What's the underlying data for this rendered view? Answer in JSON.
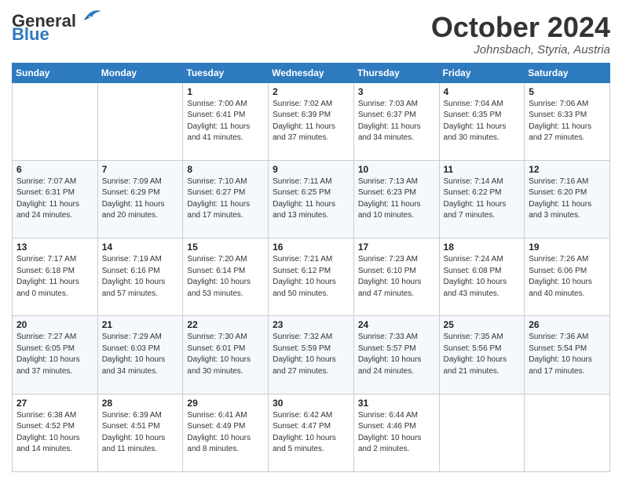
{
  "header": {
    "logo_line1": "General",
    "logo_line2": "Blue",
    "title": "October 2024",
    "location": "Johnsbach, Styria, Austria"
  },
  "weekdays": [
    "Sunday",
    "Monday",
    "Tuesday",
    "Wednesday",
    "Thursday",
    "Friday",
    "Saturday"
  ],
  "weeks": [
    [
      null,
      null,
      {
        "day": 1,
        "sunrise": "Sunrise: 7:00 AM",
        "sunset": "Sunset: 6:41 PM",
        "daylight": "Daylight: 11 hours and 41 minutes."
      },
      {
        "day": 2,
        "sunrise": "Sunrise: 7:02 AM",
        "sunset": "Sunset: 6:39 PM",
        "daylight": "Daylight: 11 hours and 37 minutes."
      },
      {
        "day": 3,
        "sunrise": "Sunrise: 7:03 AM",
        "sunset": "Sunset: 6:37 PM",
        "daylight": "Daylight: 11 hours and 34 minutes."
      },
      {
        "day": 4,
        "sunrise": "Sunrise: 7:04 AM",
        "sunset": "Sunset: 6:35 PM",
        "daylight": "Daylight: 11 hours and 30 minutes."
      },
      {
        "day": 5,
        "sunrise": "Sunrise: 7:06 AM",
        "sunset": "Sunset: 6:33 PM",
        "daylight": "Daylight: 11 hours and 27 minutes."
      }
    ],
    [
      {
        "day": 6,
        "sunrise": "Sunrise: 7:07 AM",
        "sunset": "Sunset: 6:31 PM",
        "daylight": "Daylight: 11 hours and 24 minutes."
      },
      {
        "day": 7,
        "sunrise": "Sunrise: 7:09 AM",
        "sunset": "Sunset: 6:29 PM",
        "daylight": "Daylight: 11 hours and 20 minutes."
      },
      {
        "day": 8,
        "sunrise": "Sunrise: 7:10 AM",
        "sunset": "Sunset: 6:27 PM",
        "daylight": "Daylight: 11 hours and 17 minutes."
      },
      {
        "day": 9,
        "sunrise": "Sunrise: 7:11 AM",
        "sunset": "Sunset: 6:25 PM",
        "daylight": "Daylight: 11 hours and 13 minutes."
      },
      {
        "day": 10,
        "sunrise": "Sunrise: 7:13 AM",
        "sunset": "Sunset: 6:23 PM",
        "daylight": "Daylight: 11 hours and 10 minutes."
      },
      {
        "day": 11,
        "sunrise": "Sunrise: 7:14 AM",
        "sunset": "Sunset: 6:22 PM",
        "daylight": "Daylight: 11 hours and 7 minutes."
      },
      {
        "day": 12,
        "sunrise": "Sunrise: 7:16 AM",
        "sunset": "Sunset: 6:20 PM",
        "daylight": "Daylight: 11 hours and 3 minutes."
      }
    ],
    [
      {
        "day": 13,
        "sunrise": "Sunrise: 7:17 AM",
        "sunset": "Sunset: 6:18 PM",
        "daylight": "Daylight: 11 hours and 0 minutes."
      },
      {
        "day": 14,
        "sunrise": "Sunrise: 7:19 AM",
        "sunset": "Sunset: 6:16 PM",
        "daylight": "Daylight: 10 hours and 57 minutes."
      },
      {
        "day": 15,
        "sunrise": "Sunrise: 7:20 AM",
        "sunset": "Sunset: 6:14 PM",
        "daylight": "Daylight: 10 hours and 53 minutes."
      },
      {
        "day": 16,
        "sunrise": "Sunrise: 7:21 AM",
        "sunset": "Sunset: 6:12 PM",
        "daylight": "Daylight: 10 hours and 50 minutes."
      },
      {
        "day": 17,
        "sunrise": "Sunrise: 7:23 AM",
        "sunset": "Sunset: 6:10 PM",
        "daylight": "Daylight: 10 hours and 47 minutes."
      },
      {
        "day": 18,
        "sunrise": "Sunrise: 7:24 AM",
        "sunset": "Sunset: 6:08 PM",
        "daylight": "Daylight: 10 hours and 43 minutes."
      },
      {
        "day": 19,
        "sunrise": "Sunrise: 7:26 AM",
        "sunset": "Sunset: 6:06 PM",
        "daylight": "Daylight: 10 hours and 40 minutes."
      }
    ],
    [
      {
        "day": 20,
        "sunrise": "Sunrise: 7:27 AM",
        "sunset": "Sunset: 6:05 PM",
        "daylight": "Daylight: 10 hours and 37 minutes."
      },
      {
        "day": 21,
        "sunrise": "Sunrise: 7:29 AM",
        "sunset": "Sunset: 6:03 PM",
        "daylight": "Daylight: 10 hours and 34 minutes."
      },
      {
        "day": 22,
        "sunrise": "Sunrise: 7:30 AM",
        "sunset": "Sunset: 6:01 PM",
        "daylight": "Daylight: 10 hours and 30 minutes."
      },
      {
        "day": 23,
        "sunrise": "Sunrise: 7:32 AM",
        "sunset": "Sunset: 5:59 PM",
        "daylight": "Daylight: 10 hours and 27 minutes."
      },
      {
        "day": 24,
        "sunrise": "Sunrise: 7:33 AM",
        "sunset": "Sunset: 5:57 PM",
        "daylight": "Daylight: 10 hours and 24 minutes."
      },
      {
        "day": 25,
        "sunrise": "Sunrise: 7:35 AM",
        "sunset": "Sunset: 5:56 PM",
        "daylight": "Daylight: 10 hours and 21 minutes."
      },
      {
        "day": 26,
        "sunrise": "Sunrise: 7:36 AM",
        "sunset": "Sunset: 5:54 PM",
        "daylight": "Daylight: 10 hours and 17 minutes."
      }
    ],
    [
      {
        "day": 27,
        "sunrise": "Sunrise: 6:38 AM",
        "sunset": "Sunset: 4:52 PM",
        "daylight": "Daylight: 10 hours and 14 minutes."
      },
      {
        "day": 28,
        "sunrise": "Sunrise: 6:39 AM",
        "sunset": "Sunset: 4:51 PM",
        "daylight": "Daylight: 10 hours and 11 minutes."
      },
      {
        "day": 29,
        "sunrise": "Sunrise: 6:41 AM",
        "sunset": "Sunset: 4:49 PM",
        "daylight": "Daylight: 10 hours and 8 minutes."
      },
      {
        "day": 30,
        "sunrise": "Sunrise: 6:42 AM",
        "sunset": "Sunset: 4:47 PM",
        "daylight": "Daylight: 10 hours and 5 minutes."
      },
      {
        "day": 31,
        "sunrise": "Sunrise: 6:44 AM",
        "sunset": "Sunset: 4:46 PM",
        "daylight": "Daylight: 10 hours and 2 minutes."
      },
      null,
      null
    ]
  ]
}
